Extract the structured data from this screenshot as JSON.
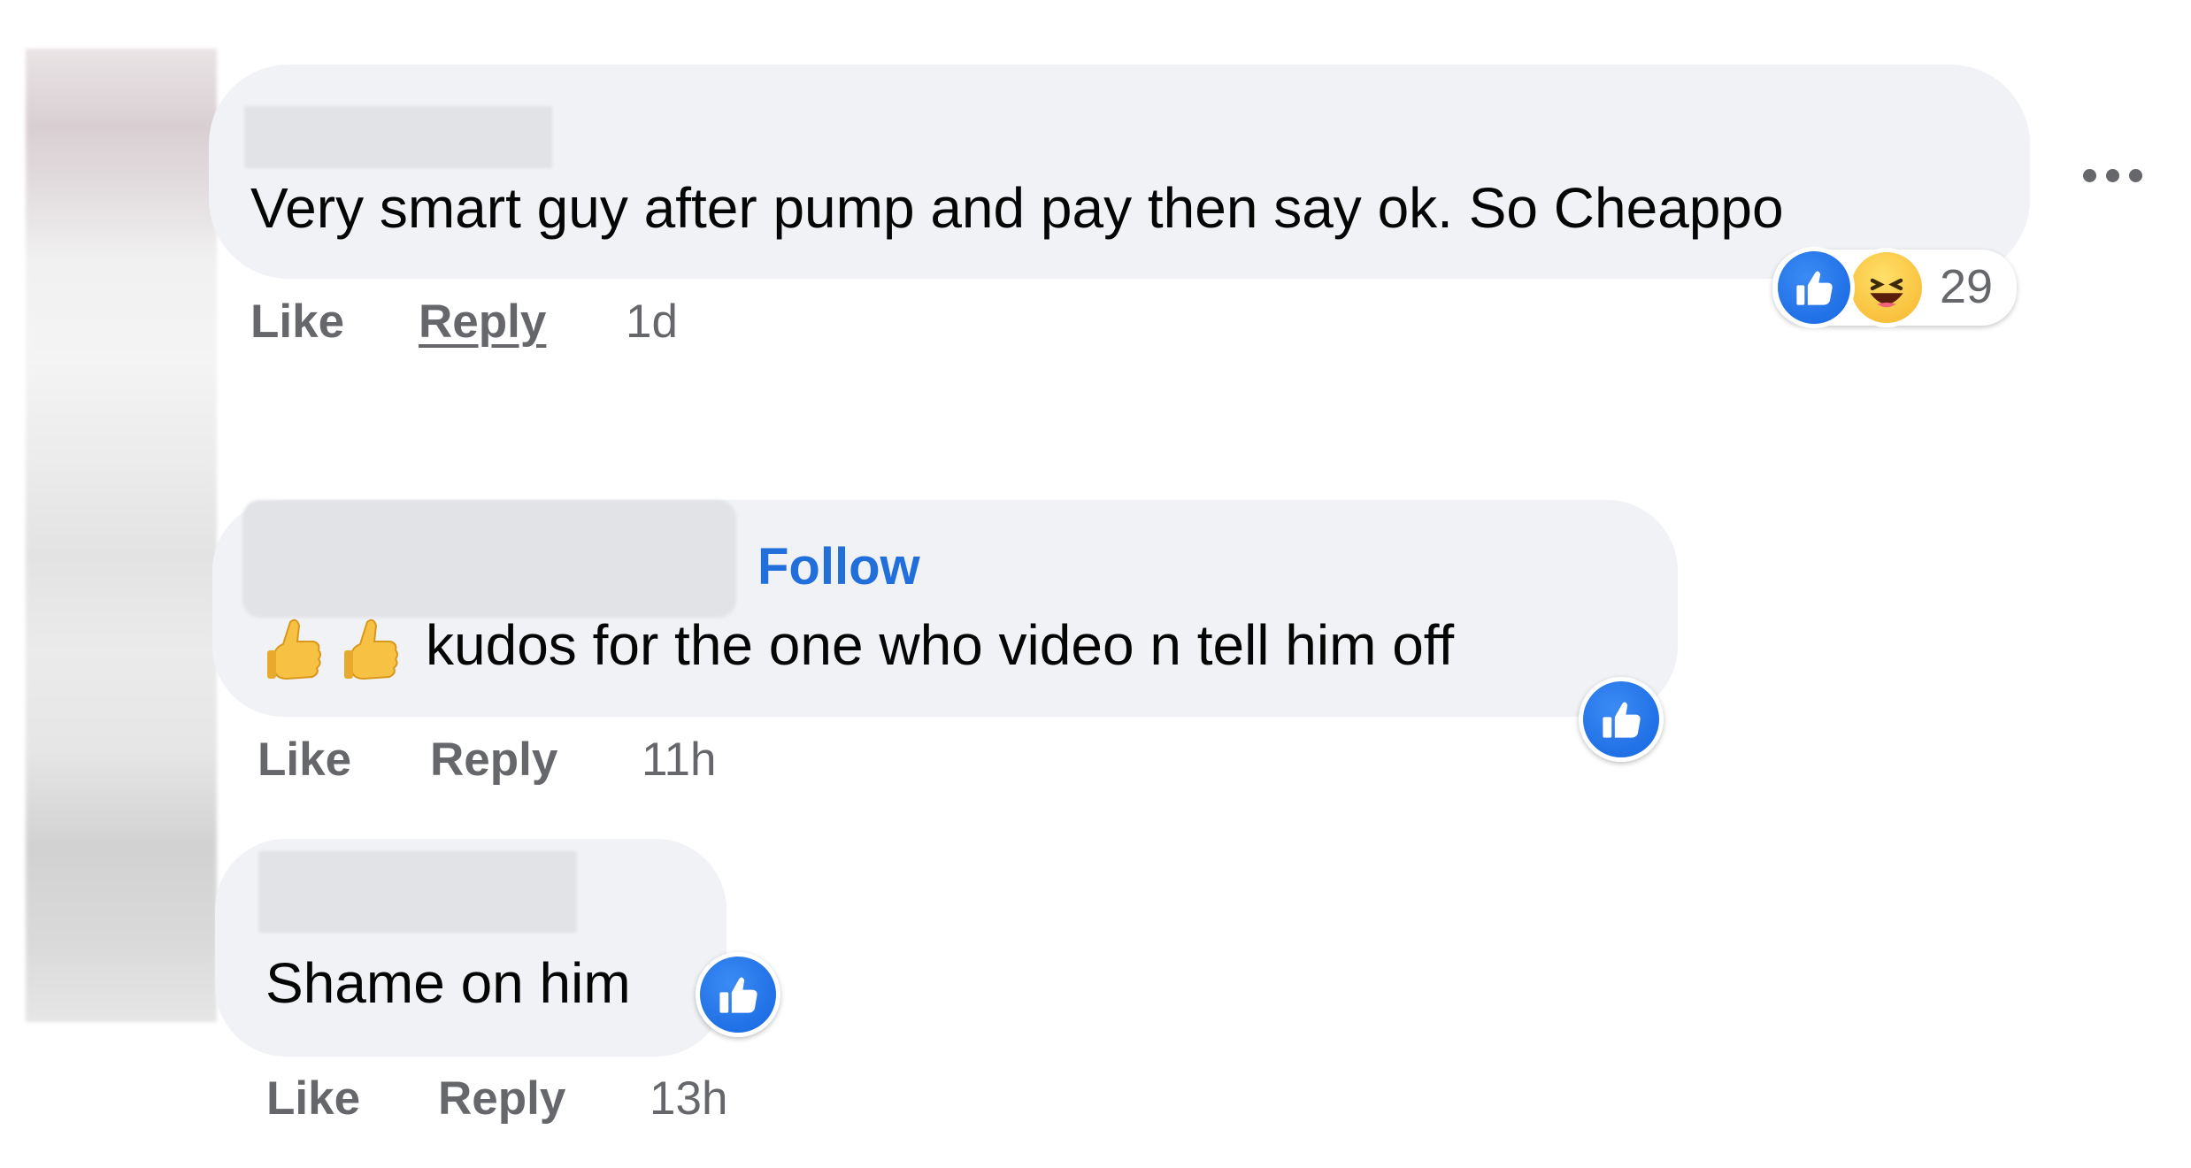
{
  "comments": [
    {
      "text": "Very smart guy after pump and pay then say ok. So Cheappo",
      "actions": {
        "like": "Like",
        "reply": "Reply",
        "time": "1d"
      },
      "reactions": {
        "icons": [
          "like-icon",
          "haha-icon"
        ],
        "count": "29"
      }
    },
    {
      "follow_label": "Follow",
      "emoji": [
        "thumbs-up-emoji",
        "thumbs-up-emoji"
      ],
      "text": "kudos for the one who video n tell him off",
      "actions": {
        "like": "Like",
        "reply": "Reply",
        "time": "11h"
      },
      "reactions": {
        "icons": [
          "like-icon"
        ]
      }
    },
    {
      "text": "Shame on him",
      "actions": {
        "like": "Like",
        "reply": "Reply",
        "time": "13h"
      },
      "reactions": {
        "icons": [
          "like-icon"
        ]
      }
    }
  ],
  "colors": {
    "bubble": "#f0f2f5",
    "secondary_text": "#65676b",
    "link": "#216fdb",
    "like_blue": "#1877f2"
  },
  "menu_icon": "more-horizontal-icon"
}
